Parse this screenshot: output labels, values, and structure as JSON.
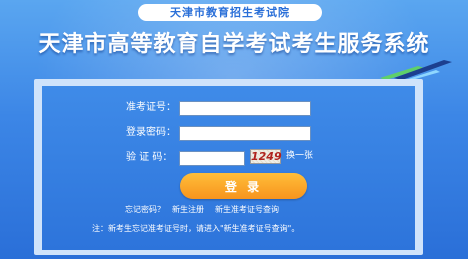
{
  "header": {
    "institute": "天津市教育招生考试院",
    "title": "天津市高等教育自学考试考生服务系统"
  },
  "login_form": {
    "exam_id_label": "准考证号：",
    "exam_id_value": "",
    "password_label": "登录密码：",
    "password_value": "",
    "captcha_label": "验 证 码：",
    "captcha_value": "",
    "captcha_image_text": "1249",
    "refresh_label": "换一张",
    "submit_label": "登 录"
  },
  "links": {
    "forgot_password": "忘记密码？",
    "new_register": "新生注册",
    "lookup_exam_id": "新生准考证号查询"
  },
  "notice": "注：新考生忘记准考证号时，请进入\"新生准考证号查询\"。",
  "colors": {
    "background": "#3c86e6",
    "panel": "#2d74db",
    "accent_button": "#f7941d",
    "captcha_text": "#b0231e"
  }
}
